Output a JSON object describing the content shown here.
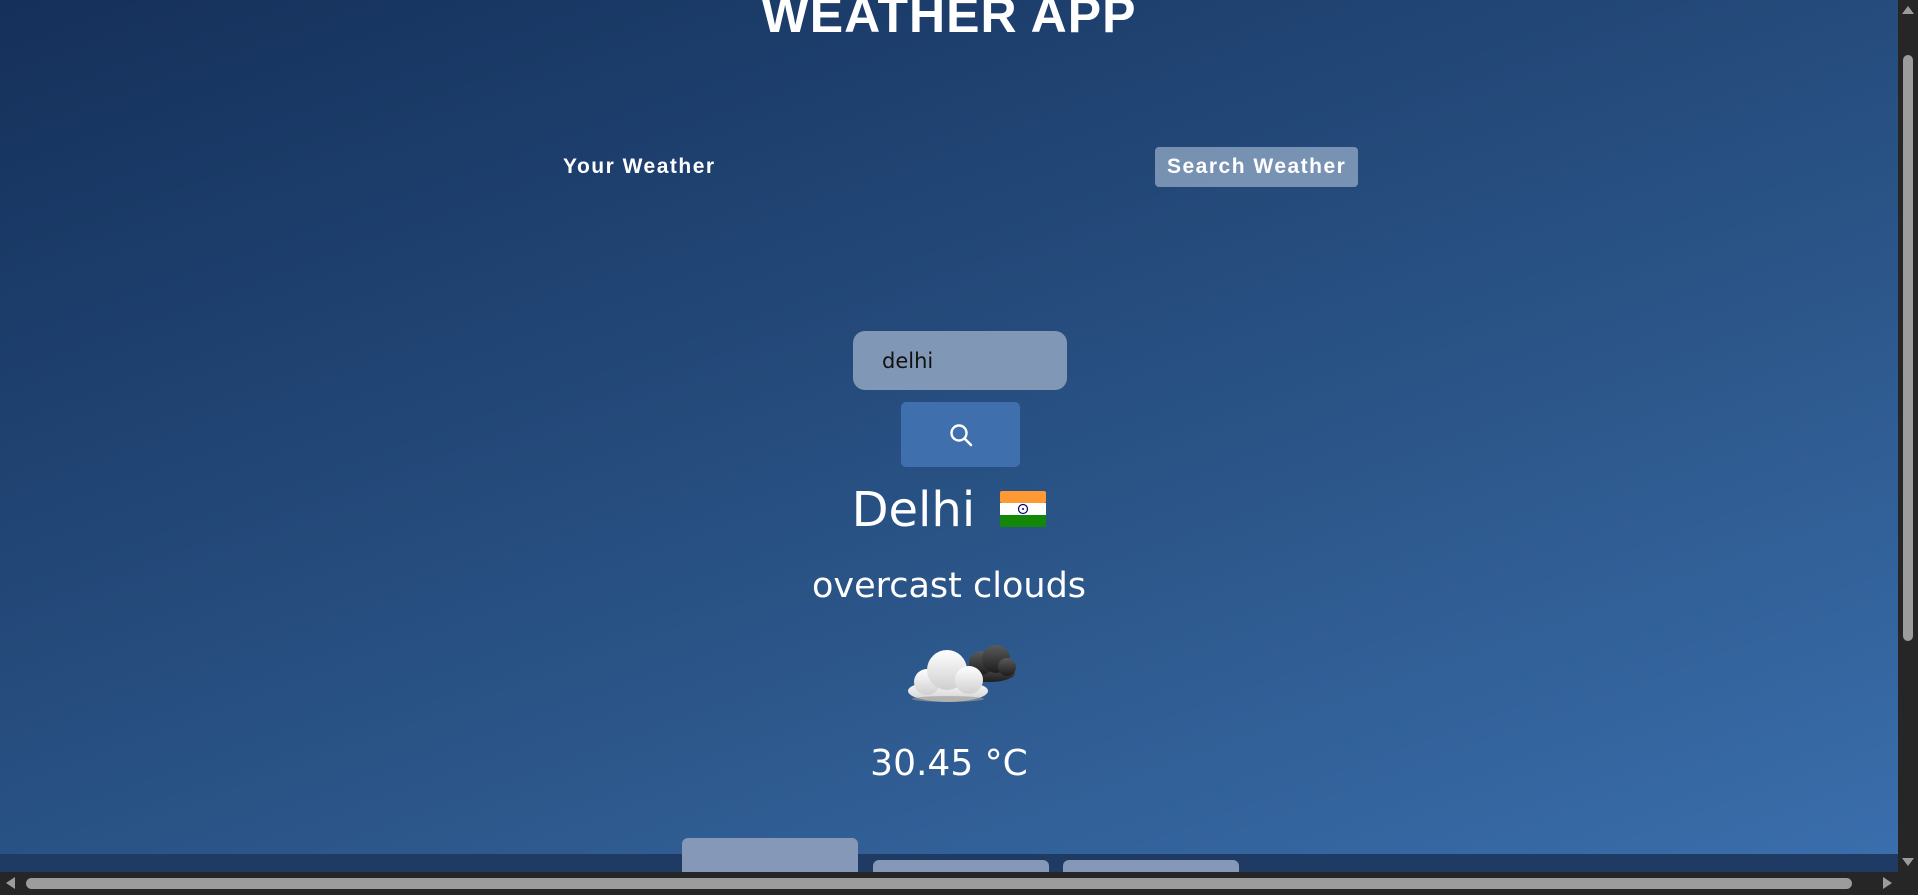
{
  "app": {
    "title": "WEATHER APP"
  },
  "tabs": [
    {
      "label": "Your Weather",
      "active": false
    },
    {
      "label": "Search Weather",
      "active": true
    }
  ],
  "search": {
    "value": "delhi",
    "button_icon": "search-icon"
  },
  "weather": {
    "city": "Delhi",
    "country_flag_icon": "india-flag-icon",
    "description": "overcast clouds",
    "condition_icon": "overcast-clouds-icon",
    "temperature": "30.45 °C"
  },
  "colors": {
    "background_start": "#15305a",
    "background_end": "#3a6eac",
    "active_tab": "#b4c3d9",
    "search_input": "#8197b6",
    "search_button": "#3f6fad",
    "card": "#8598b7"
  }
}
